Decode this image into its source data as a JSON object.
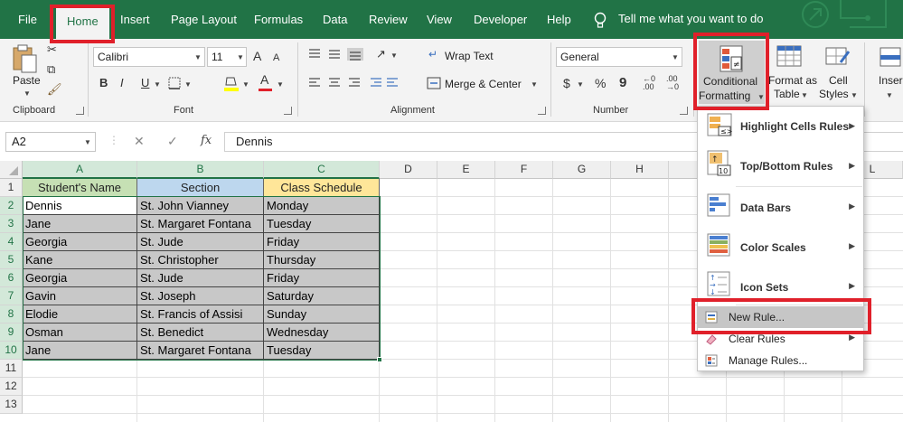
{
  "tabs": [
    "File",
    "Home",
    "Insert",
    "Page Layout",
    "Formulas",
    "Data",
    "Review",
    "View",
    "Developer",
    "Help"
  ],
  "tell_me": "Tell me what you want to do",
  "clipboard": {
    "paste": "Paste",
    "group": "Clipboard"
  },
  "font": {
    "name": "Calibri",
    "size": "11",
    "group": "Font",
    "bold": "B",
    "italic": "I",
    "underline": "U",
    "grow": "A",
    "shrink": "A",
    "fontcolor": "A"
  },
  "alignment": {
    "wrap": "Wrap Text",
    "merge": "Merge & Center",
    "group": "Alignment"
  },
  "number": {
    "format": "General",
    "group": "Number",
    "currency": "$",
    "percent": "%",
    "comma": "9"
  },
  "styles": {
    "cf_line1": "Conditional",
    "cf_line2": "Formatting",
    "fat_line1": "Format as",
    "fat_line2": "Table",
    "cs_line1": "Cell",
    "cs_line2": "Styles",
    "insert": "Inser"
  },
  "formula_bar": {
    "name_box": "A2",
    "fx": "fx",
    "value": "Dennis"
  },
  "columns": [
    "A",
    "B",
    "C",
    "D",
    "E",
    "F",
    "G",
    "H",
    "I",
    "J",
    "K",
    "L"
  ],
  "rows": [
    "1",
    "2",
    "3",
    "4",
    "5",
    "6",
    "7",
    "8",
    "9",
    "10",
    "11",
    "12",
    "13"
  ],
  "table": {
    "headers": [
      "Student's Name",
      "Section",
      "Class Schedule"
    ],
    "rows": [
      [
        "Dennis",
        "St. John Vianney",
        "Monday"
      ],
      [
        "Jane",
        "St. Margaret Fontana",
        "Tuesday"
      ],
      [
        "Georgia",
        "St. Jude",
        "Friday"
      ],
      [
        "Kane",
        "St. Christopher",
        "Thursday"
      ],
      [
        "Georgia",
        "St. Jude",
        "Friday"
      ],
      [
        "Gavin",
        "St. Joseph",
        "Saturday"
      ],
      [
        "Elodie",
        "St. Francis of Assisi",
        "Sunday"
      ],
      [
        "Osman",
        "St. Benedict",
        "Wednesday"
      ],
      [
        "Jane",
        "St. Margaret Fontana",
        "Tuesday"
      ]
    ]
  },
  "cf_menu": {
    "highlight": "Highlight Cells Rules",
    "topbottom": "Top/Bottom Rules",
    "databars": "Data Bars",
    "colorscales": "Color Scales",
    "iconsets": "Icon Sets",
    "newrule": "New Rule...",
    "clearrules": "Clear Rules",
    "managerules": "Manage Rules..."
  },
  "colors": {
    "excel_green": "#217346",
    "highlight_red": "#e0202a",
    "header_a": "#c6e0b4",
    "header_b": "#bdd7ee",
    "header_c": "#ffe699",
    "data_fill": "#c8c8c8"
  }
}
